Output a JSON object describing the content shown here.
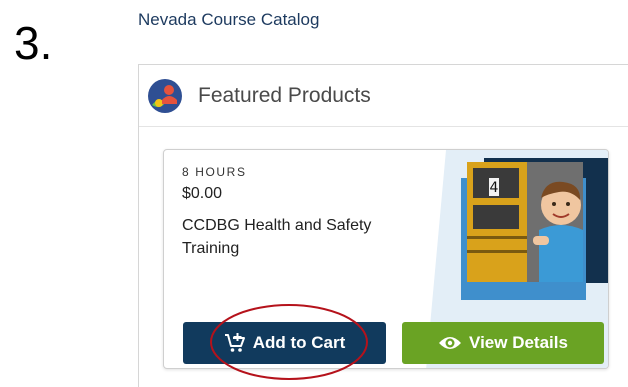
{
  "step_label": "3.",
  "catalog_title": "Nevada Course Catalog",
  "panel": {
    "title": "Featured Products",
    "logo_icon": "person-group-logo-icon"
  },
  "product": {
    "hours": "8 HOURS",
    "price": "$0.00",
    "name": "CCDBG Health and Safety Training",
    "image": "school-bus-child-photo"
  },
  "buttons": {
    "add_to_cart": "Add to Cart",
    "add_to_cart_icon": "cart-plus-icon",
    "view_details": "View Details",
    "view_details_icon": "eye-icon"
  },
  "colors": {
    "cart_button": "#113a5d",
    "details_button": "#6aa324",
    "highlight": "#b5121b",
    "link": "#1d3a5f"
  }
}
